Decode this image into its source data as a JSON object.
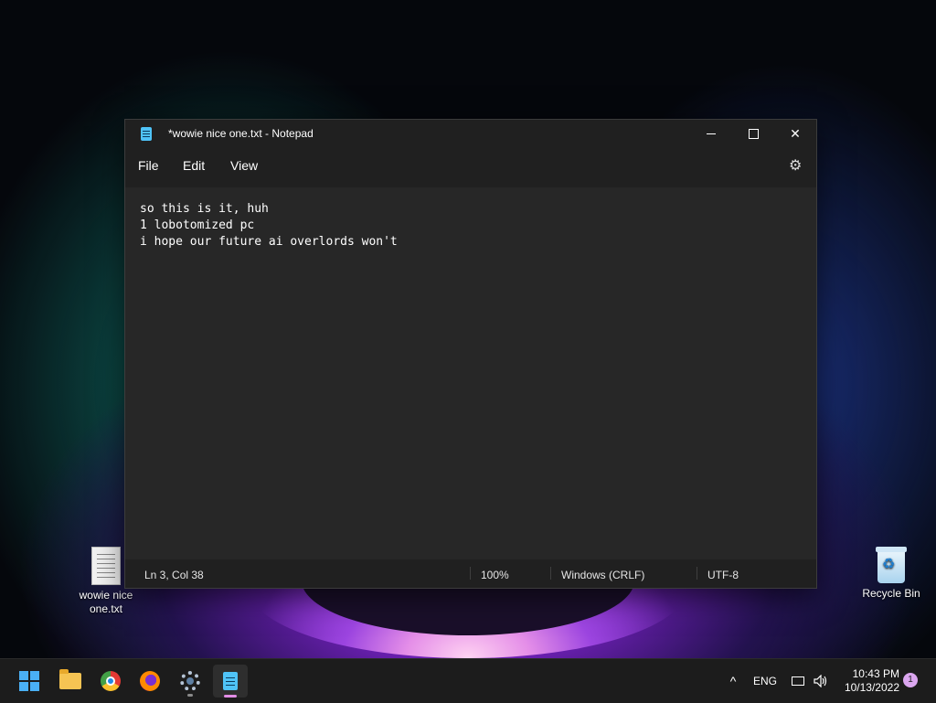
{
  "desktop": {
    "icons": [
      {
        "label": "wowie nice one.txt",
        "label_line1": "wowie nice",
        "label_line2": "one.txt",
        "icon": "text-file-icon"
      },
      {
        "label": "Recycle Bin",
        "icon": "recycle-bin-icon"
      }
    ]
  },
  "window": {
    "title": "*wowie nice one.txt - Notepad",
    "app_icon": "notepad-icon",
    "controls": {
      "minimize": "minimize-icon",
      "maximize": "maximize-icon",
      "close": "close-icon"
    },
    "menu": {
      "file": "File",
      "edit": "Edit",
      "view": "View",
      "settings_icon": "gear-icon"
    },
    "content_lines": [
      "so this is it, huh",
      "1 lobotomized pc",
      "i hope our future ai overlords won't"
    ],
    "status": {
      "position": "Ln 3, Col 38",
      "zoom": "100%",
      "line_ending": "Windows (CRLF)",
      "encoding": "UTF-8"
    }
  },
  "taskbar": {
    "apps": [
      {
        "name": "start",
        "icon": "windows-logo-icon"
      },
      {
        "name": "file-explorer",
        "icon": "folder-icon"
      },
      {
        "name": "chrome",
        "icon": "chrome-icon"
      },
      {
        "name": "firefox",
        "icon": "firefox-icon"
      },
      {
        "name": "settings",
        "icon": "settings-gear-icon"
      },
      {
        "name": "notepad",
        "icon": "notepad-icon",
        "active": true
      }
    ],
    "tray": {
      "language": "ENG",
      "time": "10:43 PM",
      "date": "10/13/2022",
      "notifications": "1"
    }
  },
  "colors": {
    "window_bg": "#272727",
    "titlebar_bg": "#202020",
    "taskbar_bg": "#1c1c1c",
    "active_indicator": "#e28de6",
    "notification_badge": "#dba6ef"
  }
}
